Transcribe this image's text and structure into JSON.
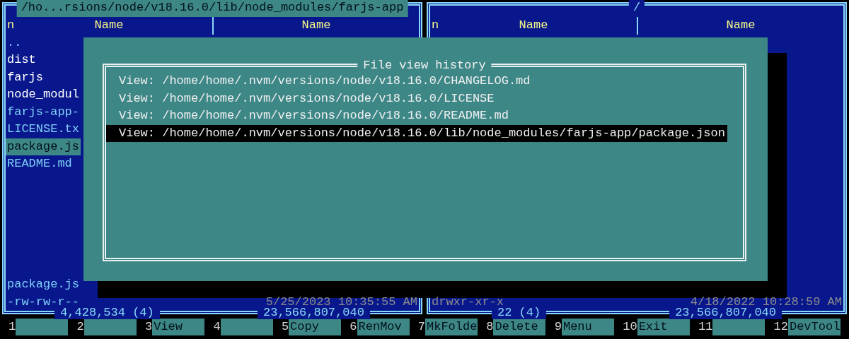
{
  "left_panel": {
    "active": true,
    "title": "/ho...rsions/node/v18.16.0/lib/node_modules/farjs-app",
    "sort": "n",
    "headers": [
      "Name",
      "Name"
    ],
    "files": [
      {
        "name": "..",
        "kind": "parent",
        "selected": false
      },
      {
        "name": "dist",
        "kind": "dir",
        "selected": false
      },
      {
        "name": "farjs",
        "kind": "dir",
        "selected": false
      },
      {
        "name": "node_modul",
        "kind": "dir",
        "selected": false
      },
      {
        "name": "farjs-app-",
        "kind": "file",
        "selected": false
      },
      {
        "name": "LICENSE.tx",
        "kind": "file",
        "selected": false
      },
      {
        "name": "package.js",
        "kind": "file",
        "selected": true
      },
      {
        "name": "README.md",
        "kind": "file",
        "selected": false
      }
    ],
    "current_file": "package.js",
    "attributes": "-rw-rw-r--",
    "modified": "5/25/2023 10:35:55 AM",
    "total": "4,428,534 (4)",
    "free": "23,566,807,040"
  },
  "right_panel": {
    "active": false,
    "title": "/",
    "sort": "n",
    "headers": [
      "Name",
      "Name"
    ],
    "attributes": "drwxr-xr-x",
    "modified": "4/18/2022 10:28:59 AM",
    "total": "22 (4)",
    "free": "23,566,807,040"
  },
  "dialog": {
    "title": "File view history",
    "items": [
      {
        "label": "View: /home/home/.nvm/versions/node/v18.16.0/CHANGELOG.md",
        "selected": false
      },
      {
        "label": "View: /home/home/.nvm/versions/node/v18.16.0/LICENSE",
        "selected": false
      },
      {
        "label": "View: /home/home/.nvm/versions/node/v18.16.0/README.md",
        "selected": false
      },
      {
        "label": "View: /home/home/.nvm/versions/node/v18.16.0/lib/node_modules/farjs-app/package.json",
        "selected": true
      }
    ]
  },
  "keybar": [
    {
      "key": "1"
    },
    {
      "key": "2"
    },
    {
      "key": "3",
      "label": "View"
    },
    {
      "key": "4"
    },
    {
      "key": "5",
      "label": "Copy"
    },
    {
      "key": "6",
      "label": "RenMov"
    },
    {
      "key": "7",
      "label": "MkFolde"
    },
    {
      "key": "8",
      "label": "Delete"
    },
    {
      "key": "9",
      "label": "Menu"
    },
    {
      "key": "10",
      "label": "Exit"
    },
    {
      "key": "11"
    },
    {
      "key": "12",
      "label": "DevTool"
    }
  ]
}
